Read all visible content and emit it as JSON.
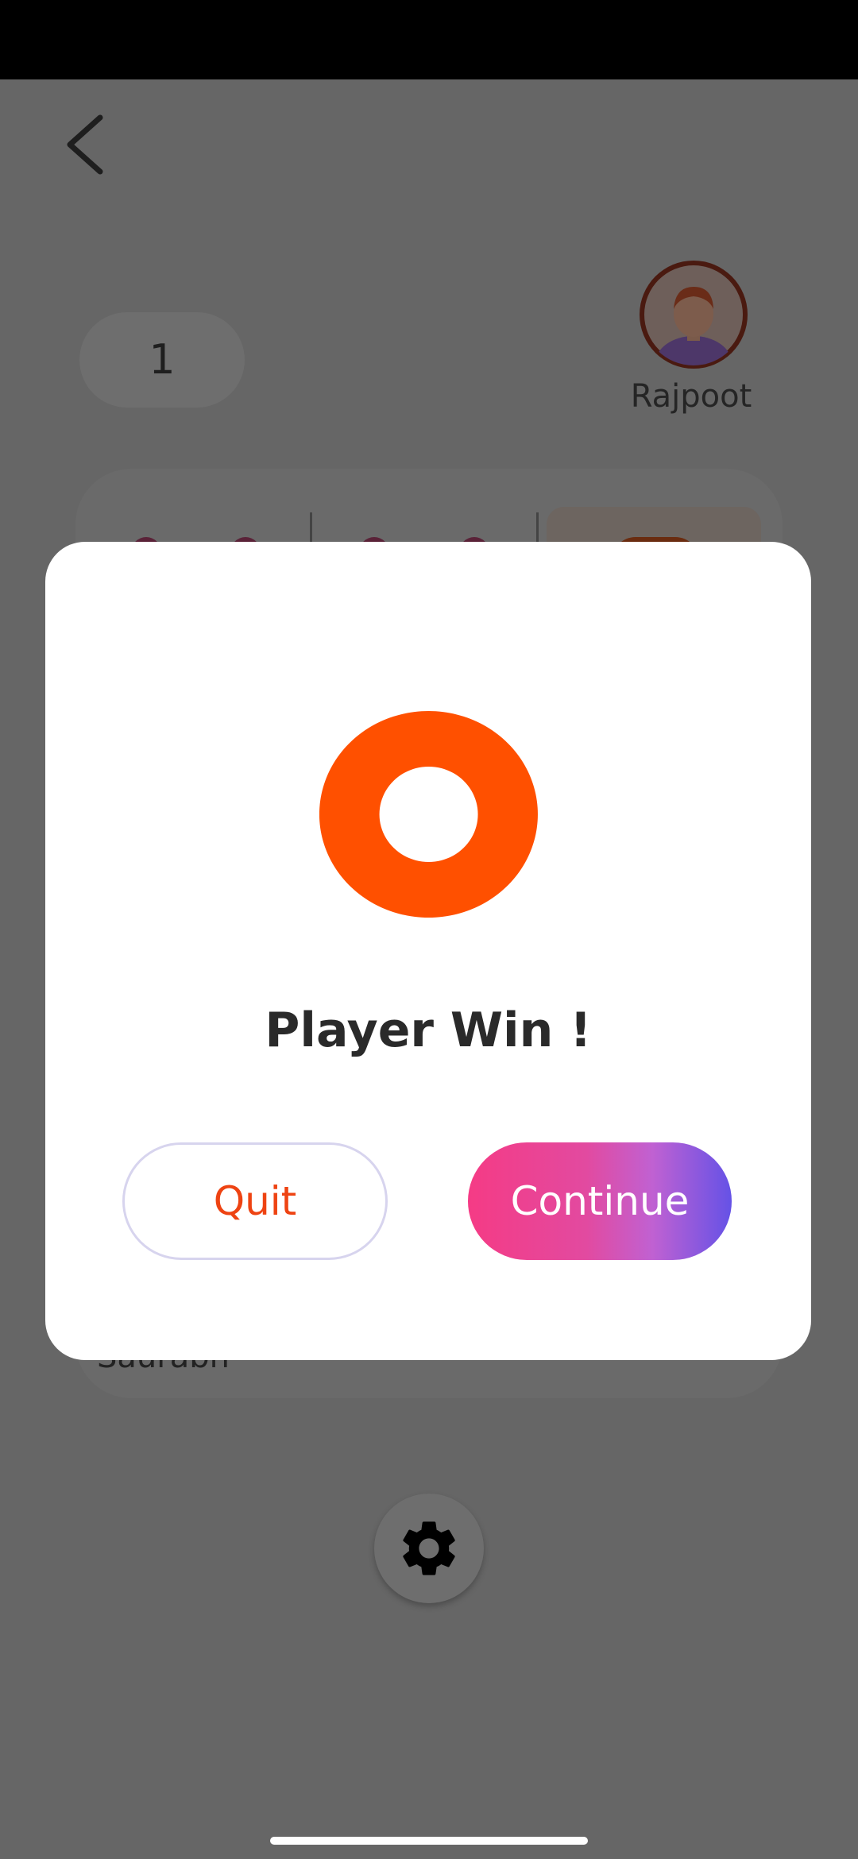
{
  "game": {
    "score": "1",
    "opponent_name": "Rajpoot",
    "player_name": "Saurabh"
  },
  "dialog": {
    "title": "Player Win !",
    "quit_label": "Quit",
    "continue_label": "Continue"
  },
  "colors": {
    "accent_orange": "#ff5000",
    "quit_text": "#ee4312",
    "continue_gradient_start": "#f53b85",
    "continue_gradient_end": "#6552e6"
  },
  "icons": {
    "back": "chevron-left-icon",
    "settings": "gear-icon",
    "result": "ring-icon"
  }
}
